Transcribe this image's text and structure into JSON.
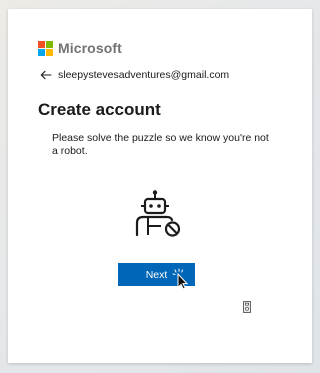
{
  "brand": {
    "name": "Microsoft",
    "logo_colors": [
      "#f25022",
      "#7fba00",
      "#00a4ef",
      "#ffb900"
    ]
  },
  "identity": {
    "back_icon": "back-arrow-icon",
    "email": "sleepystevesadventures@gmail.com"
  },
  "page": {
    "title": "Create account",
    "description": "Please solve the puzzle so we know you're not a robot."
  },
  "puzzle": {
    "icon": "robot-blocked-icon"
  },
  "actions": {
    "next_label": "Next",
    "accent": "#0067b8"
  },
  "footer": {
    "icon": "audio-challenge-icon"
  }
}
